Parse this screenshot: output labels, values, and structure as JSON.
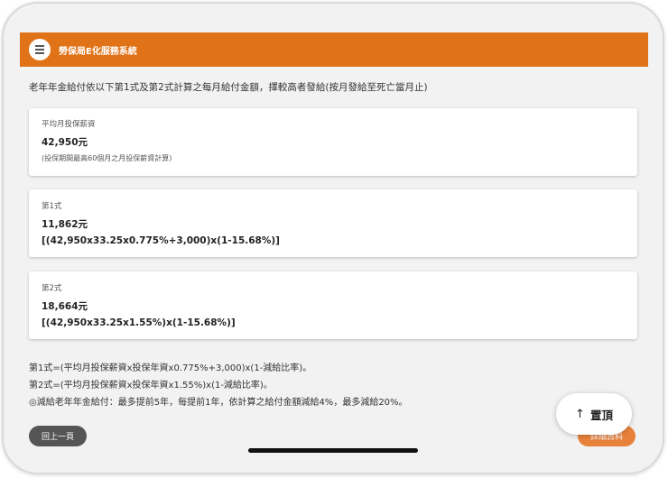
{
  "header": {
    "title": "勞保局E化服務系統",
    "menu_icon": "hamburger-menu-icon"
  },
  "intro": "老年年金給付依以下第1式及第2式計算之每月給付金額，擇較高者發給(按月發給至死亡當月止)",
  "cards": [
    {
      "label": "平均月投保薪資",
      "value": "42,950元",
      "note": "(投保期間最高60個月之月投保薪資計算)"
    },
    {
      "label": "第1式",
      "value": "11,862元",
      "formula": "[(42,950x33.25x0.775%+3,000)x(1-15.68%)]"
    },
    {
      "label": "第2式",
      "value": "18,664元",
      "formula": "[(42,950x33.25x1.55%)x(1-15.68%)]"
    }
  ],
  "footnotes": [
    "第1式=(平均月投保薪資x投保年資x0.775%+3,000)x(1-減給比率)。",
    "第2式=(平均月投保薪資x投保年資x1.55%)x(1-減給比率)。",
    "◎減給老年年金給付：最多提前5年，每提前1年，依計算之給付金額減給4%，最多減給20%。"
  ],
  "buttons": {
    "back": "回上一頁",
    "detail": "詳細資料",
    "top": "置頂"
  },
  "colors": {
    "brand": "#e07318",
    "back_button": "#555555",
    "detail_button": "#e8823a"
  }
}
